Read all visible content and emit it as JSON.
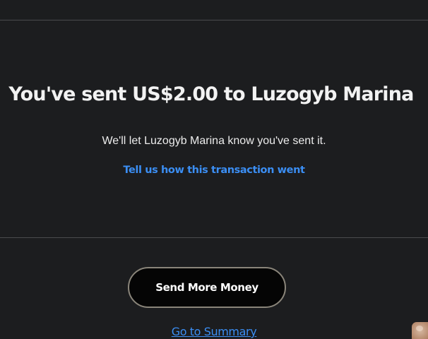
{
  "confirmation": {
    "headline": "You've sent US$2.00 to Luzogyb Marina",
    "subtext": "We'll let Luzogyb Marina know you've sent it.",
    "feedback_link": "Tell us how this transaction went"
  },
  "actions": {
    "send_more_label": "Send More Money",
    "summary_link": "Go to Summary"
  },
  "colors": {
    "background": "#1c1d1f",
    "link": "#3b8ef3",
    "button_bg": "#050505",
    "button_border": "#8a857a",
    "divider": "#4a4b4e"
  },
  "icons": {
    "corner_widget": "avatar-thumbnail"
  }
}
